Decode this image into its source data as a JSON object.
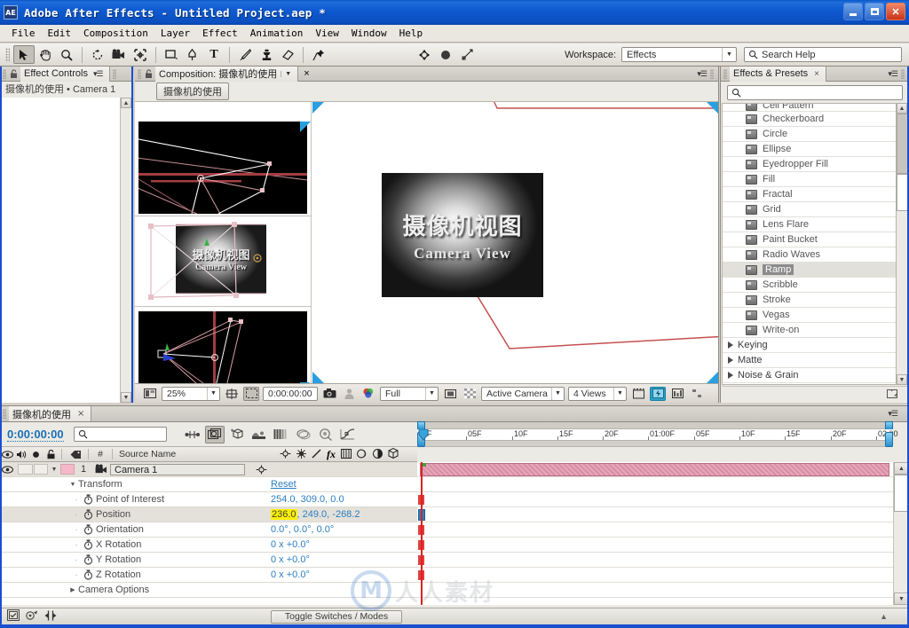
{
  "window": {
    "title": "Adobe After Effects - Untitled Project.aep *",
    "app_icon": "AE",
    "minimize": "_",
    "maximize": "□",
    "close": "✕"
  },
  "menubar": {
    "items": [
      "File",
      "Edit",
      "Composition",
      "Layer",
      "Effect",
      "Animation",
      "View",
      "Window",
      "Help"
    ]
  },
  "toolbar": {
    "tools": [
      {
        "name": "selection-tool",
        "glyph": "➤",
        "selected": true
      },
      {
        "name": "hand-tool",
        "glyph": "✋",
        "selected": false
      },
      {
        "name": "zoom-tool",
        "glyph": "🔍",
        "selected": false
      },
      {
        "name": "rotation-tool",
        "glyph": "↻",
        "selected": false
      },
      {
        "name": "camera-tool",
        "glyph": "🎥",
        "selected": false
      },
      {
        "name": "pan-behind-tool",
        "glyph": "✥",
        "selected": false
      },
      {
        "name": "shape-tool",
        "glyph": "▭",
        "selected": false
      },
      {
        "name": "pen-tool",
        "glyph": "✒",
        "selected": false
      },
      {
        "name": "text-tool",
        "glyph": "T",
        "selected": false
      },
      {
        "name": "brush-tool",
        "glyph": "🖌",
        "selected": false
      },
      {
        "name": "clone-stamp-tool",
        "glyph": "⚲",
        "selected": false
      },
      {
        "name": "eraser-tool",
        "glyph": "◺",
        "selected": false
      },
      {
        "name": "puppet-pin-tool",
        "glyph": "📌",
        "selected": false
      }
    ],
    "extras": [
      {
        "name": "axis-mode-icon",
        "glyph": "✥"
      },
      {
        "name": "shaded-view-icon",
        "glyph": "●"
      },
      {
        "name": "snapping-icon",
        "glyph": "⌗"
      }
    ],
    "workspace_label": "Workspace:",
    "workspace_value": "Effects",
    "search_help_placeholder": "Search Help",
    "search_icon": "search-icon"
  },
  "effect_controls": {
    "tab_label": "Effect Controls",
    "subtitle": "摄像机的使用 • Camera 1",
    "panel_menu": "▾☰"
  },
  "composition": {
    "tab_label": "Composition: 摄像机的使用",
    "tab_close": "×",
    "comp_chip": "摄像机的使用",
    "panel_menu": "▾☰",
    "viewer_text_cn": "摄像机视图",
    "viewer_text_en": "Camera View",
    "bottom_bar": {
      "zoom_value": "25%",
      "timecode": "0:00:00:00",
      "resolution": "Full",
      "view_select": "Active Camera",
      "views_count": "4 Views",
      "toggle_grid_icon": "grid-icon",
      "region_of_interest_icon": "roi-icon",
      "take_snapshot_icon": "camera-icon",
      "show_snapshot_icon": "person-icon",
      "channel_icon": "channel-rgb-icon",
      "transparency_grid_icon": "transparency-grid-icon",
      "toggle_view_layout_icon": "views-layout-icon",
      "3d_view_icon": "3d-view-icon",
      "timeline_icon": "timeline-icon"
    }
  },
  "effects_presets": {
    "tab_label": "Effects & Presets",
    "tab_close": "×",
    "search_placeholder": "",
    "search_icon": "search-icon",
    "panel_menu": "▾☰",
    "items": [
      {
        "label": "Cell Pattern",
        "type": "effect",
        "selected": false,
        "clipped": true
      },
      {
        "label": "Checkerboard",
        "type": "effect",
        "selected": false
      },
      {
        "label": "Circle",
        "type": "effect",
        "selected": false
      },
      {
        "label": "Ellipse",
        "type": "effect",
        "selected": false
      },
      {
        "label": "Eyedropper Fill",
        "type": "effect",
        "selected": false
      },
      {
        "label": "Fill",
        "type": "effect",
        "selected": false
      },
      {
        "label": "Fractal",
        "type": "effect",
        "selected": false
      },
      {
        "label": "Grid",
        "type": "effect",
        "selected": false
      },
      {
        "label": "Lens Flare",
        "type": "effect",
        "selected": false
      },
      {
        "label": "Paint Bucket",
        "type": "effect",
        "selected": false
      },
      {
        "label": "Radio Waves",
        "type": "effect",
        "selected": false
      },
      {
        "label": "Ramp",
        "type": "effect",
        "selected": true
      },
      {
        "label": "Scribble",
        "type": "effect",
        "selected": false
      },
      {
        "label": "Stroke",
        "type": "effect",
        "selected": false
      },
      {
        "label": "Vegas",
        "type": "effect",
        "selected": false
      },
      {
        "label": "Write-on",
        "type": "effect",
        "selected": false
      },
      {
        "label": "Keying",
        "type": "category",
        "selected": false
      },
      {
        "label": "Matte",
        "type": "category",
        "selected": false
      },
      {
        "label": "Noise & Grain",
        "type": "category",
        "selected": false
      }
    ],
    "footer_icon": "new-folder-icon"
  },
  "timeline": {
    "tab_label": "摄像机的使用",
    "tab_close": "×",
    "current_time": "0:00:00:00",
    "search_placeholder": "",
    "tool_icons": [
      "composition-mini-flowchart-icon",
      "draft-3d-icon",
      "hide-shy-layers-icon",
      "enable-frame-blending-icon",
      "enable-motion-blur-icon",
      "brainstorm-icon",
      "auto-keyframe-icon",
      "graph-editor-icon"
    ],
    "columns": {
      "eye": "video-icon",
      "audio": "audio-icon",
      "solo": "solo-icon",
      "lock": "lock-icon",
      "label": "label-icon",
      "index": "#",
      "source_name": "Source Name"
    },
    "switch_icons": [
      "shy-icon",
      "collapse-icon",
      "quality-icon",
      "effects-icon",
      "frame-blend-icon",
      "motion-blur-icon",
      "adjustment-icon",
      "3d-layer-icon"
    ],
    "layers": [
      {
        "index": "1",
        "name": "Camera 1",
        "type": "camera",
        "label_color": "#f5b8c8",
        "selected": true,
        "expanded": true
      }
    ],
    "properties": [
      {
        "name": "Transform",
        "value": "Reset",
        "indent": 1,
        "group": true,
        "expanded": true
      },
      {
        "name": "Point of Interest",
        "value": "254.0,  309.0,  0.0",
        "indent": 2,
        "stopwatch": true,
        "highlighted": false
      },
      {
        "name": "Position",
        "value": "236.0,  249.0,  -268.2",
        "indent": 2,
        "stopwatch": true,
        "highlighted": true,
        "selected": true
      },
      {
        "name": "Orientation",
        "value": "0.0°,  0.0°,  0.0°",
        "indent": 2,
        "stopwatch": true,
        "highlighted": false
      },
      {
        "name": "X Rotation",
        "value": "0 x  +0.0°",
        "indent": 2,
        "stopwatch": true,
        "highlighted": false
      },
      {
        "name": "Y Rotation",
        "value": "0 x  +0.0°",
        "indent": 2,
        "stopwatch": true,
        "highlighted": false
      },
      {
        "name": "Z Rotation",
        "value": "0 x  +0.0°",
        "indent": 2,
        "stopwatch": true,
        "highlighted": false
      },
      {
        "name": "Camera Options",
        "value": "",
        "indent": 1,
        "group": true,
        "expanded": false
      }
    ],
    "ruler_labels": [
      "0F",
      "05F",
      "10F",
      "15F",
      "20F",
      "01:00F",
      "05F",
      "10F",
      "15F",
      "20F",
      "02:00"
    ],
    "footer": {
      "toggle_switches_label": "Toggle Switches / Modes",
      "icons": [
        "comp-flowchart-icon",
        "frame-render-icon",
        "stretch-icon"
      ]
    }
  },
  "colors": {
    "accent_blue": "#1a4fd0",
    "property_value_blue": "#2b7ec1",
    "highlight_yellow": "#fcf000",
    "layer_bar_pink": "#db8ca4",
    "playhead_red": "#e02020",
    "panel_bg": "#eceae4"
  },
  "watermark": {
    "text": "人人素材",
    "mark": "M"
  }
}
